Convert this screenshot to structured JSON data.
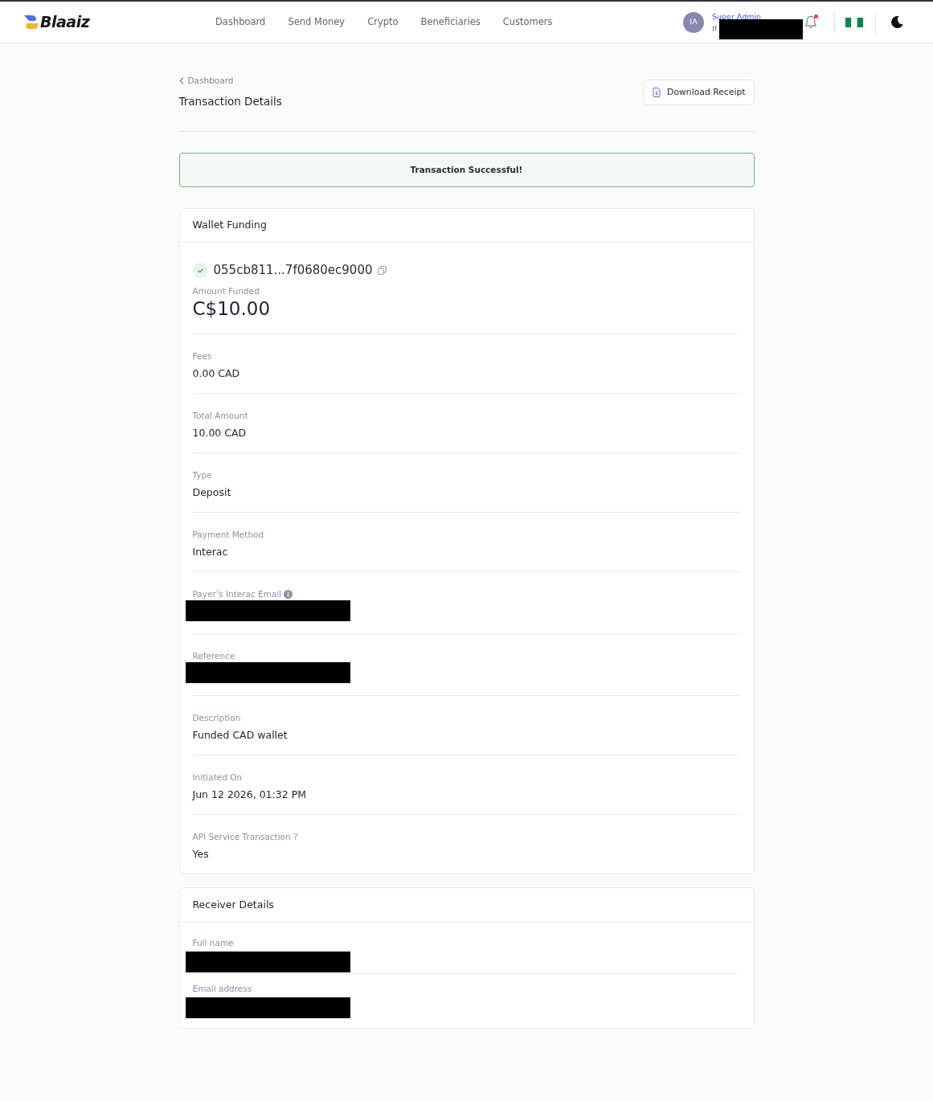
{
  "header": {
    "logo": "Blaaiz",
    "nav": [
      "Dashboard",
      "Send Money",
      "Crypto",
      "Beneficiaries",
      "Customers"
    ],
    "user": {
      "initials": "IA",
      "role": "Super Admin",
      "name": "If",
      "name_redacted": true
    },
    "notifications": {
      "unread": true
    }
  },
  "page": {
    "breadcrumb": "Dashboard",
    "title": "Transaction Details",
    "download_button": "Download Receipt"
  },
  "alert": {
    "text": "Transaction Successful!"
  },
  "wallet_card": {
    "title": "Wallet Funding",
    "transaction_id": "055cb811...7f0680ec9000",
    "amount_label": "Amount Funded",
    "amount": "C$10.00",
    "fields": [
      {
        "label": "Fees",
        "value": "0.00 CAD"
      },
      {
        "label": "Total Amount",
        "value": "10.00 CAD"
      },
      {
        "label": "Type",
        "value": "Deposit"
      },
      {
        "label": "Payment Method",
        "value": "Interac"
      },
      {
        "label": "Payer’s Interac Email",
        "info": true,
        "redacted": true
      },
      {
        "label": "Reference",
        "redacted": true
      },
      {
        "label": "Description",
        "value": "Funded CAD wallet"
      },
      {
        "label": "Initiated On",
        "value": "Jun 12 2026, 01:32 PM"
      },
      {
        "label": "API Service Transaction ?",
        "value": "Yes"
      }
    ]
  },
  "receiver_card": {
    "title": "Receiver Details",
    "fields": [
      {
        "label": "Full name",
        "redacted": true
      },
      {
        "label": "Email address",
        "redacted": true
      }
    ]
  }
}
